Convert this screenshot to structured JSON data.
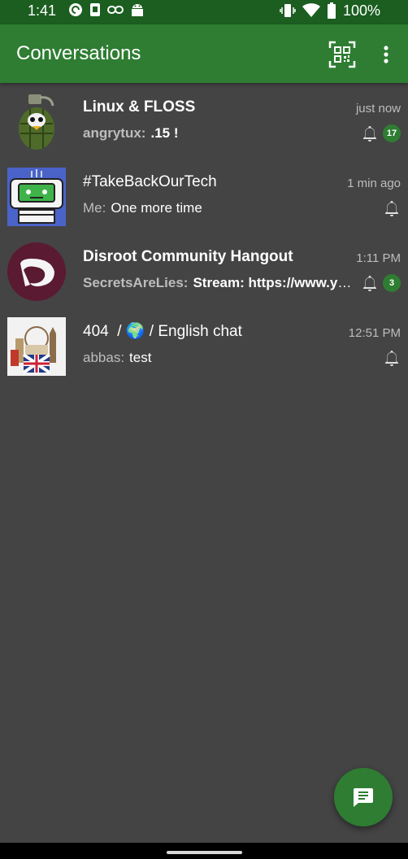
{
  "status_bar": {
    "time": "1:41",
    "battery": "100%",
    "icons": [
      "pocketcasts-icon",
      "phone-sim-icon",
      "link-icon",
      "android-icon",
      "vibrate-icon",
      "wifi-icon",
      "battery-icon"
    ]
  },
  "app_bar": {
    "title": "Conversations",
    "actions": [
      "qr-code-icon",
      "more-vert-icon"
    ]
  },
  "conversations": [
    {
      "name": "Linux & FLOSS",
      "time": "just now",
      "sender": "angrytux:",
      "message": ".15 !",
      "unread": true,
      "badge": "17",
      "avatar": "grenade-tux-avatar"
    },
    {
      "name": "#TakeBackOurTech",
      "time": "1 min ago",
      "sender": "Me:",
      "message": "One more time",
      "unread": false,
      "badge": "",
      "avatar": "robot-avatar"
    },
    {
      "name": "Disroot Community Hangout",
      "time": "1:11 PM",
      "sender": "SecretsAreLies:",
      "message": "Stream: https://www.youtube.com",
      "unread": true,
      "badge": "3",
      "avatar": "disroot-logo-avatar"
    },
    {
      "name_prefix": "404",
      "name_sep1": "/",
      "name_emoji": "🌍",
      "name_sep2": "/",
      "name_suffix": "English chat",
      "time": "12:51 PM",
      "sender": "abbas:",
      "message": "test",
      "unread": false,
      "badge": "",
      "avatar": "london-avatar"
    }
  ],
  "fab": {
    "icon": "new-chat-icon"
  },
  "colors": {
    "primary": "#2e7d32",
    "primary_dark": "#1b5e20",
    "background": "#444444",
    "secondary_text": "#bdbdbd"
  }
}
